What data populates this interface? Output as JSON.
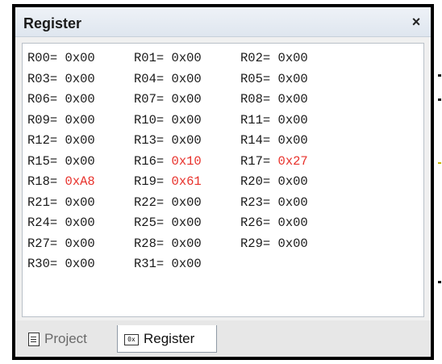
{
  "window": {
    "title": "Register",
    "close_label": "×"
  },
  "registers": [
    [
      {
        "name": "R00=",
        "value": "0x00",
        "changed": false
      },
      {
        "name": "R01=",
        "value": "0x00",
        "changed": false
      },
      {
        "name": "R02=",
        "value": "0x00",
        "changed": false
      }
    ],
    [
      {
        "name": "R03=",
        "value": "0x00",
        "changed": false
      },
      {
        "name": "R04=",
        "value": "0x00",
        "changed": false
      },
      {
        "name": "R05=",
        "value": "0x00",
        "changed": false
      }
    ],
    [
      {
        "name": "R06=",
        "value": "0x00",
        "changed": false
      },
      {
        "name": "R07=",
        "value": "0x00",
        "changed": false
      },
      {
        "name": "R08=",
        "value": "0x00",
        "changed": false
      }
    ],
    [
      {
        "name": "R09=",
        "value": "0x00",
        "changed": false
      },
      {
        "name": "R10=",
        "value": "0x00",
        "changed": false
      },
      {
        "name": "R11=",
        "value": "0x00",
        "changed": false
      }
    ],
    [
      {
        "name": "R12=",
        "value": "0x00",
        "changed": false
      },
      {
        "name": "R13=",
        "value": "0x00",
        "changed": false
      },
      {
        "name": "R14=",
        "value": "0x00",
        "changed": false
      }
    ],
    [
      {
        "name": "R15=",
        "value": "0x00",
        "changed": false
      },
      {
        "name": "R16=",
        "value": "0x10",
        "changed": true
      },
      {
        "name": "R17=",
        "value": "0x27",
        "changed": true
      }
    ],
    [
      {
        "name": "R18=",
        "value": "0xA8",
        "changed": true
      },
      {
        "name": "R19=",
        "value": "0x61",
        "changed": true
      },
      {
        "name": "R20=",
        "value": "0x00",
        "changed": false
      }
    ],
    [
      {
        "name": "R21=",
        "value": "0x00",
        "changed": false
      },
      {
        "name": "R22=",
        "value": "0x00",
        "changed": false
      },
      {
        "name": "R23=",
        "value": "0x00",
        "changed": false
      }
    ],
    [
      {
        "name": "R24=",
        "value": "0x00",
        "changed": false
      },
      {
        "name": "R25=",
        "value": "0x00",
        "changed": false
      },
      {
        "name": "R26=",
        "value": "0x00",
        "changed": false
      }
    ],
    [
      {
        "name": "R27=",
        "value": "0x00",
        "changed": false
      },
      {
        "name": "R28=",
        "value": "0x00",
        "changed": false
      },
      {
        "name": "R29=",
        "value": "0x00",
        "changed": false
      }
    ],
    [
      {
        "name": "R30=",
        "value": "0x00",
        "changed": false
      },
      {
        "name": "R31=",
        "value": "0x00",
        "changed": false
      }
    ]
  ],
  "tabs": [
    {
      "label": "Project",
      "icon": "document-icon",
      "active": false
    },
    {
      "label": "Register",
      "icon": "register-icon",
      "active": true
    }
  ],
  "colors": {
    "changed_value": "#e8312b",
    "normal_value": "#1a1a1a"
  }
}
